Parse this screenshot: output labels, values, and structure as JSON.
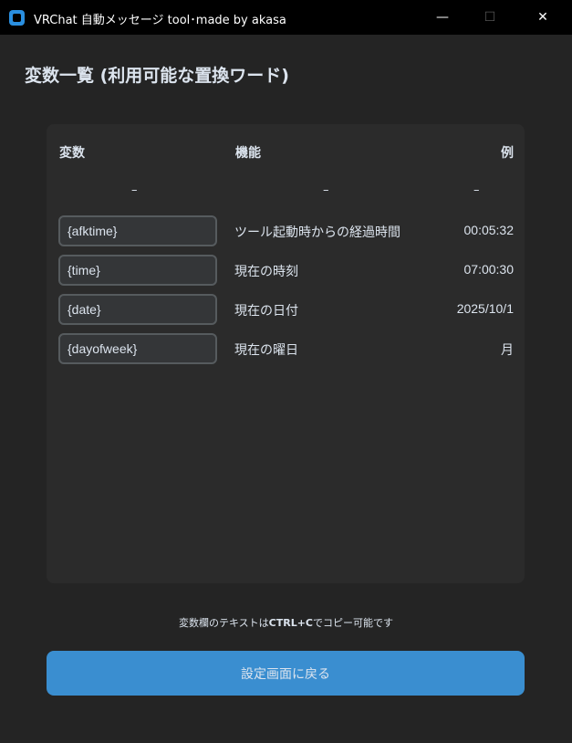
{
  "window": {
    "title": "VRChat 自動メッセージ tool･made by akasa",
    "minimize": "—",
    "maximize": "☐",
    "close": "✕"
  },
  "heading": "変数一覧 (利用可能な置換ワード)",
  "table": {
    "headers": {
      "variable": "変数",
      "function": "機能",
      "example": "例"
    },
    "dashes": [
      "–",
      "–",
      "–"
    ],
    "rows": [
      {
        "variable": "{afktime}",
        "function": "ツール起動時からの経過時間",
        "example": "00:05:32"
      },
      {
        "variable": "{time}",
        "function": "現在の時刻",
        "example": "07:00:30"
      },
      {
        "variable": "{date}",
        "function": "現在の日付",
        "example": "2025/10/1"
      },
      {
        "variable": "{dayofweek}",
        "function": "現在の曜日",
        "example": "月"
      }
    ]
  },
  "note": {
    "pre": "変数欄のテキストは",
    "bold": "CTRL+C",
    "post": "でコピー可能です"
  },
  "back_button": "設定画面に戻る"
}
